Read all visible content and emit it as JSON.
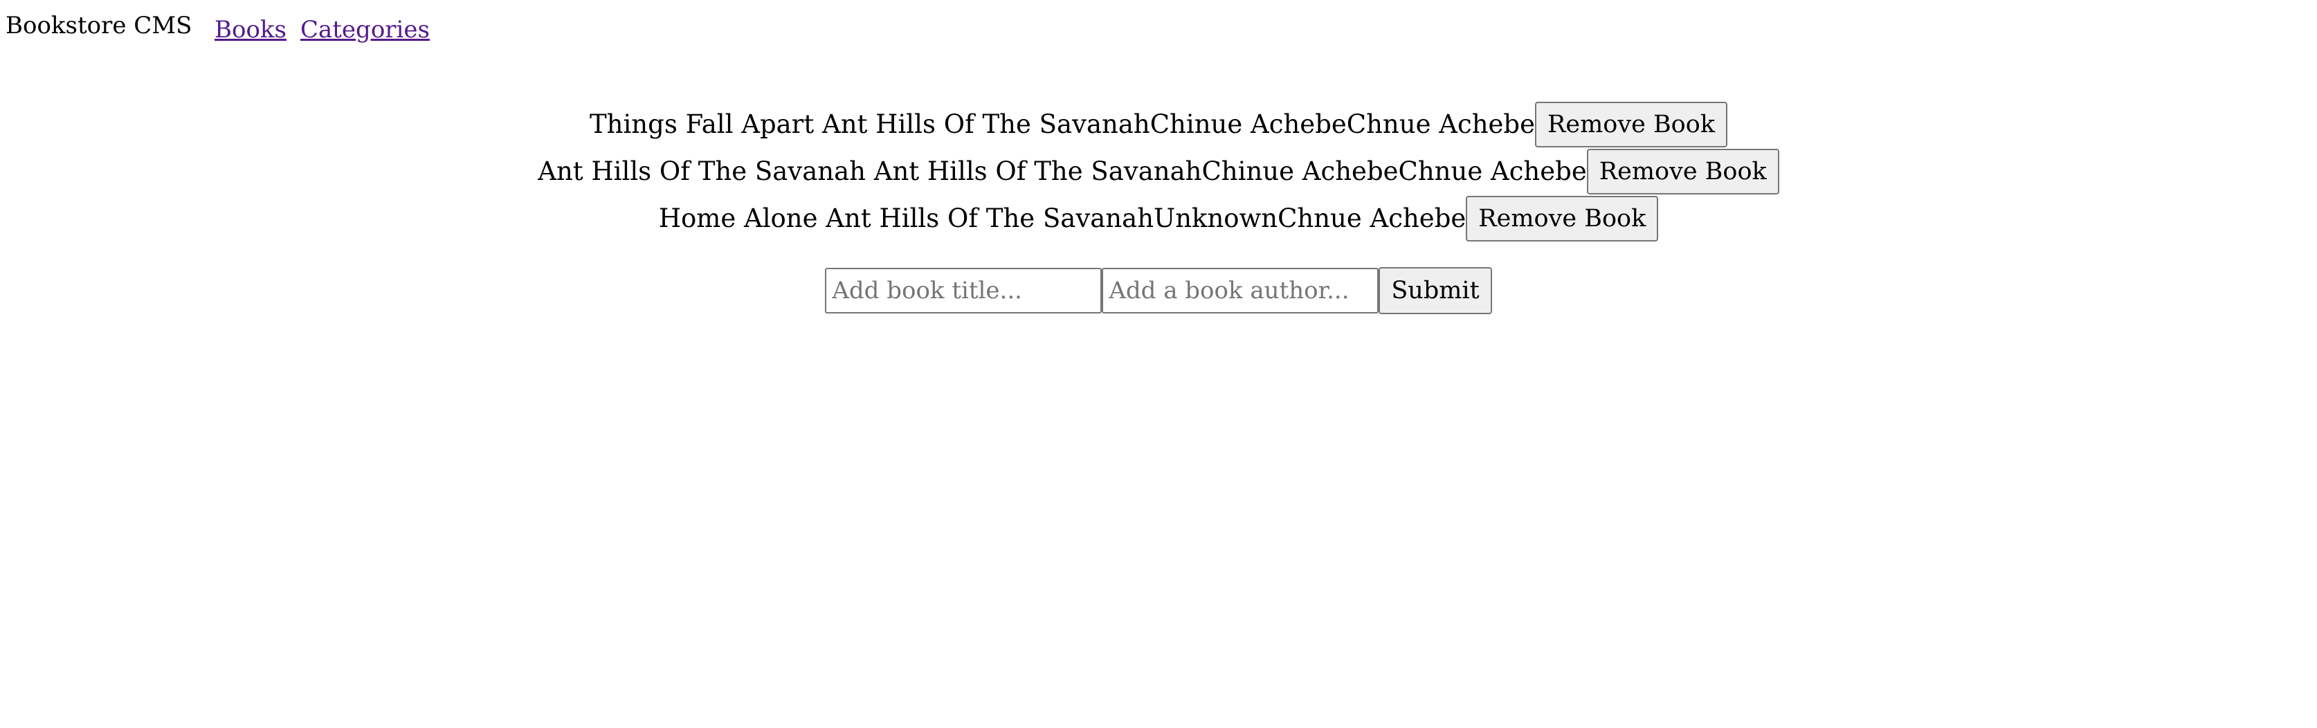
{
  "header": {
    "brand": "Bookstore CMS",
    "nav": [
      {
        "label": "Books"
      },
      {
        "label": "Categories"
      }
    ]
  },
  "books": [
    {
      "title": "Things Fall Apart Ant Hills Of The Savanah",
      "author": "Chinue Achebe",
      "category": "Chnue Achebe",
      "remove_label": "Remove Book"
    },
    {
      "title": "Ant Hills Of The Savanah Ant Hills Of The Savanah",
      "author": "Chinue Achebe",
      "category": "Chnue Achebe",
      "remove_label": "Remove Book"
    },
    {
      "title": "Home Alone Ant Hills Of The Savanah",
      "author": "Unknown",
      "category": "Chnue Achebe",
      "remove_label": "Remove Book"
    }
  ],
  "form": {
    "title_placeholder": "Add book title...",
    "author_placeholder": "Add a book author...",
    "submit_label": "Submit"
  },
  "colors": {
    "link": "#551a8b",
    "button_bg": "#efefef",
    "border": "#767676"
  }
}
